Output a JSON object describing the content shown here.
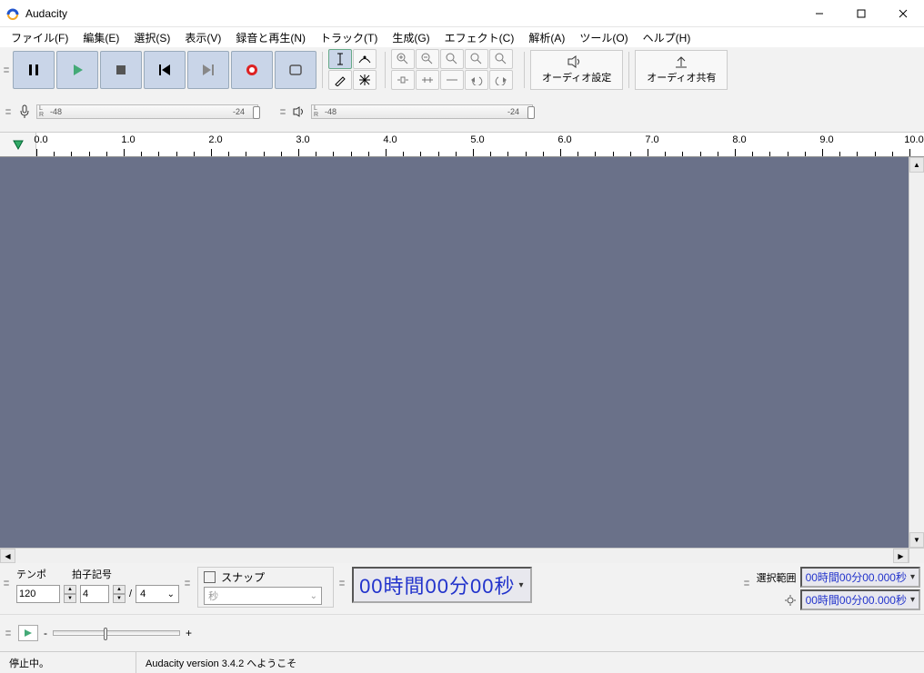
{
  "window": {
    "title": "Audacity"
  },
  "menu": {
    "file": "ファイル(F)",
    "edit": "編集(E)",
    "select": "選択(S)",
    "view": "表示(V)",
    "transport": "録音と再生(N)",
    "tracks": "トラック(T)",
    "generate": "生成(G)",
    "effect": "エフェクト(C)",
    "analyze": "解析(A)",
    "tools": "ツール(O)",
    "help": "ヘルプ(H)"
  },
  "toolbar": {
    "audio_setup": "オーディオ設定",
    "share_audio": "オーディオ共有"
  },
  "meter": {
    "labels": [
      "-48",
      "-24"
    ]
  },
  "timeline": {
    "major": [
      "0.0",
      "1.0",
      "2.0",
      "3.0",
      "4.0",
      "5.0",
      "6.0",
      "7.0",
      "8.0",
      "9.0",
      "10.0"
    ]
  },
  "bottom": {
    "tempo_label": "テンポ",
    "tempo_value": "120",
    "timesig_label": "拍子記号",
    "timesig_num": "4",
    "timesig_den": "4",
    "snap_label": "スナップ",
    "snap_unit": "秒",
    "big_time": "00時間00分00秒",
    "selection_label": "選択範囲",
    "selection_start": "00時間00分00.000秒",
    "selection_end": "00時間00分00.000秒"
  },
  "playbar": {
    "minus": "-",
    "plus": "+"
  },
  "status": {
    "state": "停止中。",
    "welcome": "Audacity version 3.4.2 へようこそ"
  }
}
